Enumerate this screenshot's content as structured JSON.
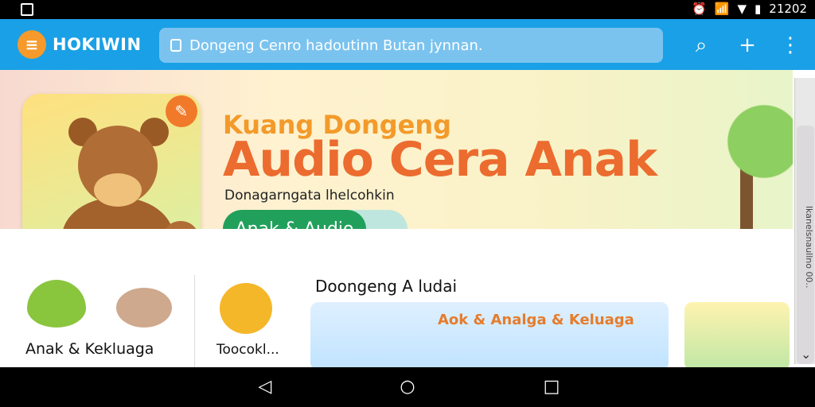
{
  "statusbar": {
    "time": "21202"
  },
  "app": {
    "name": "HOKIWIN"
  },
  "search": {
    "value": "Dongeng Cenro hadoutinn Butan jynnan."
  },
  "hero": {
    "title_line1": "Kuang Dongeng",
    "title_line2": "Audio Cera Anak",
    "subtitle": "Donagarngata lhelcohkin",
    "pill_label": "Anak & Audio",
    "side_tab_text": "lkanelsnaullno 00.."
  },
  "categories": [
    {
      "label": "Anak & Kekluaga"
    },
    {
      "label": "Toocokl..."
    }
  ],
  "section": {
    "title": "Doongeng A ludai",
    "card1_title": "Aok & Analga & Keluaga"
  },
  "colors": {
    "appbar": "#1aa0e6",
    "accent_green": "#21a05c",
    "orange": "#f07a2a"
  }
}
